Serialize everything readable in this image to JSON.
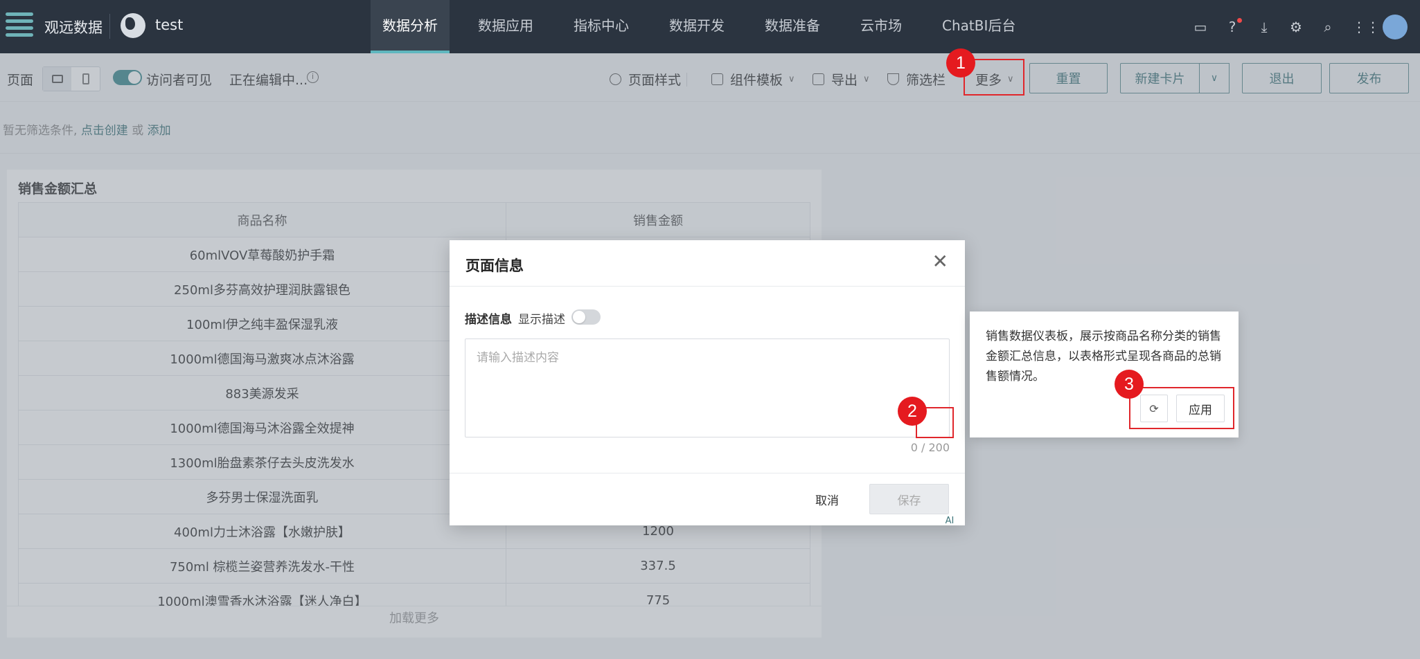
{
  "topnav": {
    "app_name": "观远数据",
    "project_name": "test",
    "tabs": [
      {
        "label": "数据分析",
        "active": true
      },
      {
        "label": "数据应用",
        "active": false
      },
      {
        "label": "指标中心",
        "active": false
      },
      {
        "label": "数据开发",
        "active": false
      },
      {
        "label": "数据准备",
        "active": false
      },
      {
        "label": "云市场",
        "active": false
      },
      {
        "label": "ChatBI后台",
        "active": false
      }
    ],
    "icons": [
      "screen-share-icon",
      "help-icon",
      "download-icon",
      "settings-icon",
      "search-icon",
      "apps-grid-icon",
      "avatar"
    ]
  },
  "toolbar": {
    "page_label": "页面",
    "visitor_visible_label": "访问者可见",
    "visitor_visible": true,
    "editing_status": "正在编辑中...",
    "page_style": "页面样式",
    "component_template": "组件模板",
    "export": "导出",
    "filter_bar": "筛选栏",
    "more": "更多",
    "reset": "重置",
    "new_card": "新建卡片",
    "exit": "退出",
    "publish": "发布"
  },
  "filter_bar": {
    "prefix": "暂无筛选条件, ",
    "create_link": "点击创建",
    "or": " 或 ",
    "add_link": "添加"
  },
  "card": {
    "title": "销售金额汇总",
    "columns": [
      "商品名称",
      "销售金额"
    ],
    "rows": [
      [
        "60mlVOV草莓酸奶护手霜",
        ""
      ],
      [
        "250ml多芬高效护理润肤露银色",
        ""
      ],
      [
        "100ml伊之纯丰盈保湿乳液",
        ""
      ],
      [
        "1000ml德国海马激爽冰点沐浴露",
        ""
      ],
      [
        "883美源发采",
        ""
      ],
      [
        "1000ml德国海马沐浴露全效提神",
        ""
      ],
      [
        "1300ml胎盘素茶仔去头皮洗发水",
        ""
      ],
      [
        "多芬男士保湿洗面乳",
        ""
      ],
      [
        "400ml力士沐浴露【水嫩护肤】",
        "1200"
      ],
      [
        "750ml 棕榄兰姿营养洗发水-干性",
        "337.5"
      ],
      [
        "1000ml澳雪香水沐浴露【迷人净白】",
        "775"
      ]
    ],
    "load_more": "加载更多"
  },
  "modal": {
    "title": "页面信息",
    "desc_label": "描述信息",
    "show_desc_label": "显示描述",
    "show_desc": false,
    "textarea_placeholder": "请输入描述内容",
    "textarea_value": "",
    "ai_label": "AI",
    "counter": "0 / 200",
    "cancel": "取消",
    "save": "保存"
  },
  "popover": {
    "text": "销售数据仪表板，展示按商品名称分类的销售金额汇总信息，以表格形式呈现各商品的总销售额情况。",
    "apply": "应用"
  },
  "callouts": [
    "1",
    "2",
    "3"
  ],
  "colors": {
    "nav_bg": "#2b3440",
    "accent": "#3d7479",
    "callout_red": "#e51a1f"
  }
}
